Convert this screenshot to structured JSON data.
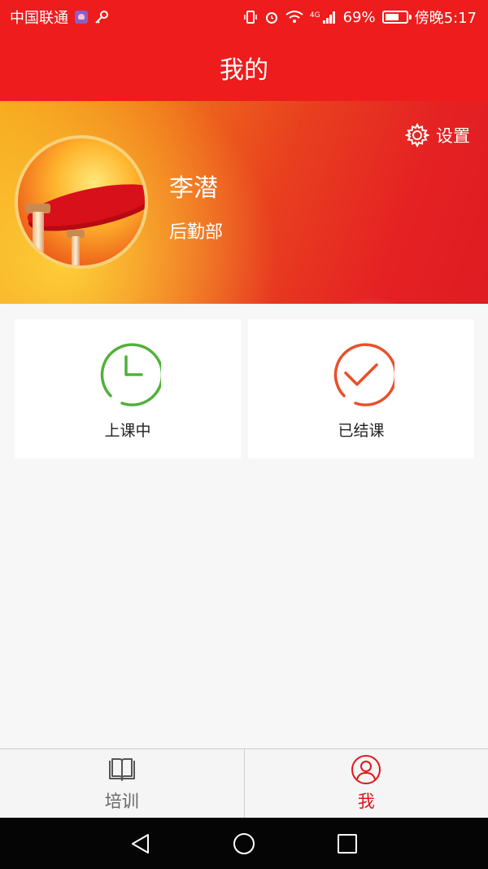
{
  "status_bar": {
    "carrier": "中国联通",
    "network_type": "4G",
    "battery_percent": "69%",
    "battery_level": 0.69,
    "time": "傍晚5:17"
  },
  "app_bar": {
    "title": "我的"
  },
  "profile": {
    "name": "李潜",
    "department": "后勤部",
    "settings_label": "设置"
  },
  "cards": [
    {
      "label": "上课中",
      "icon": "clock-icon",
      "color": "#52b03b"
    },
    {
      "label": "已结课",
      "icon": "check-circle-icon",
      "color": "#e8502a"
    }
  ],
  "bottom_nav": [
    {
      "label": "培训",
      "icon": "book-icon",
      "active": false
    },
    {
      "label": "我",
      "icon": "user-icon",
      "active": true
    }
  ],
  "colors": {
    "primary": "#ee1c1c",
    "active_tab": "#e3161b"
  }
}
